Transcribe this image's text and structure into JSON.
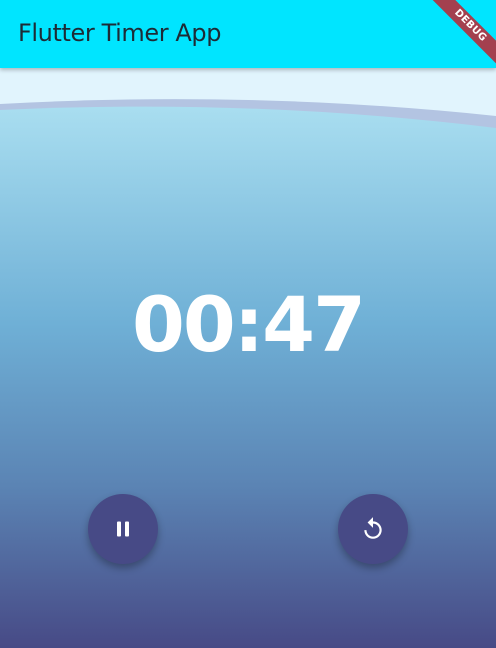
{
  "app_bar": {
    "title": "Flutter Timer App"
  },
  "debug_banner": {
    "label": "DEBUG"
  },
  "timer": {
    "display": "00:47"
  },
  "actions": {
    "pause_icon": "pause-icon",
    "reset_icon": "replay-icon"
  },
  "colors": {
    "app_bar": "#00e5ff",
    "fab": "#474a86",
    "gradient_top": "#a9def0",
    "gradient_bottom": "#474a86"
  }
}
